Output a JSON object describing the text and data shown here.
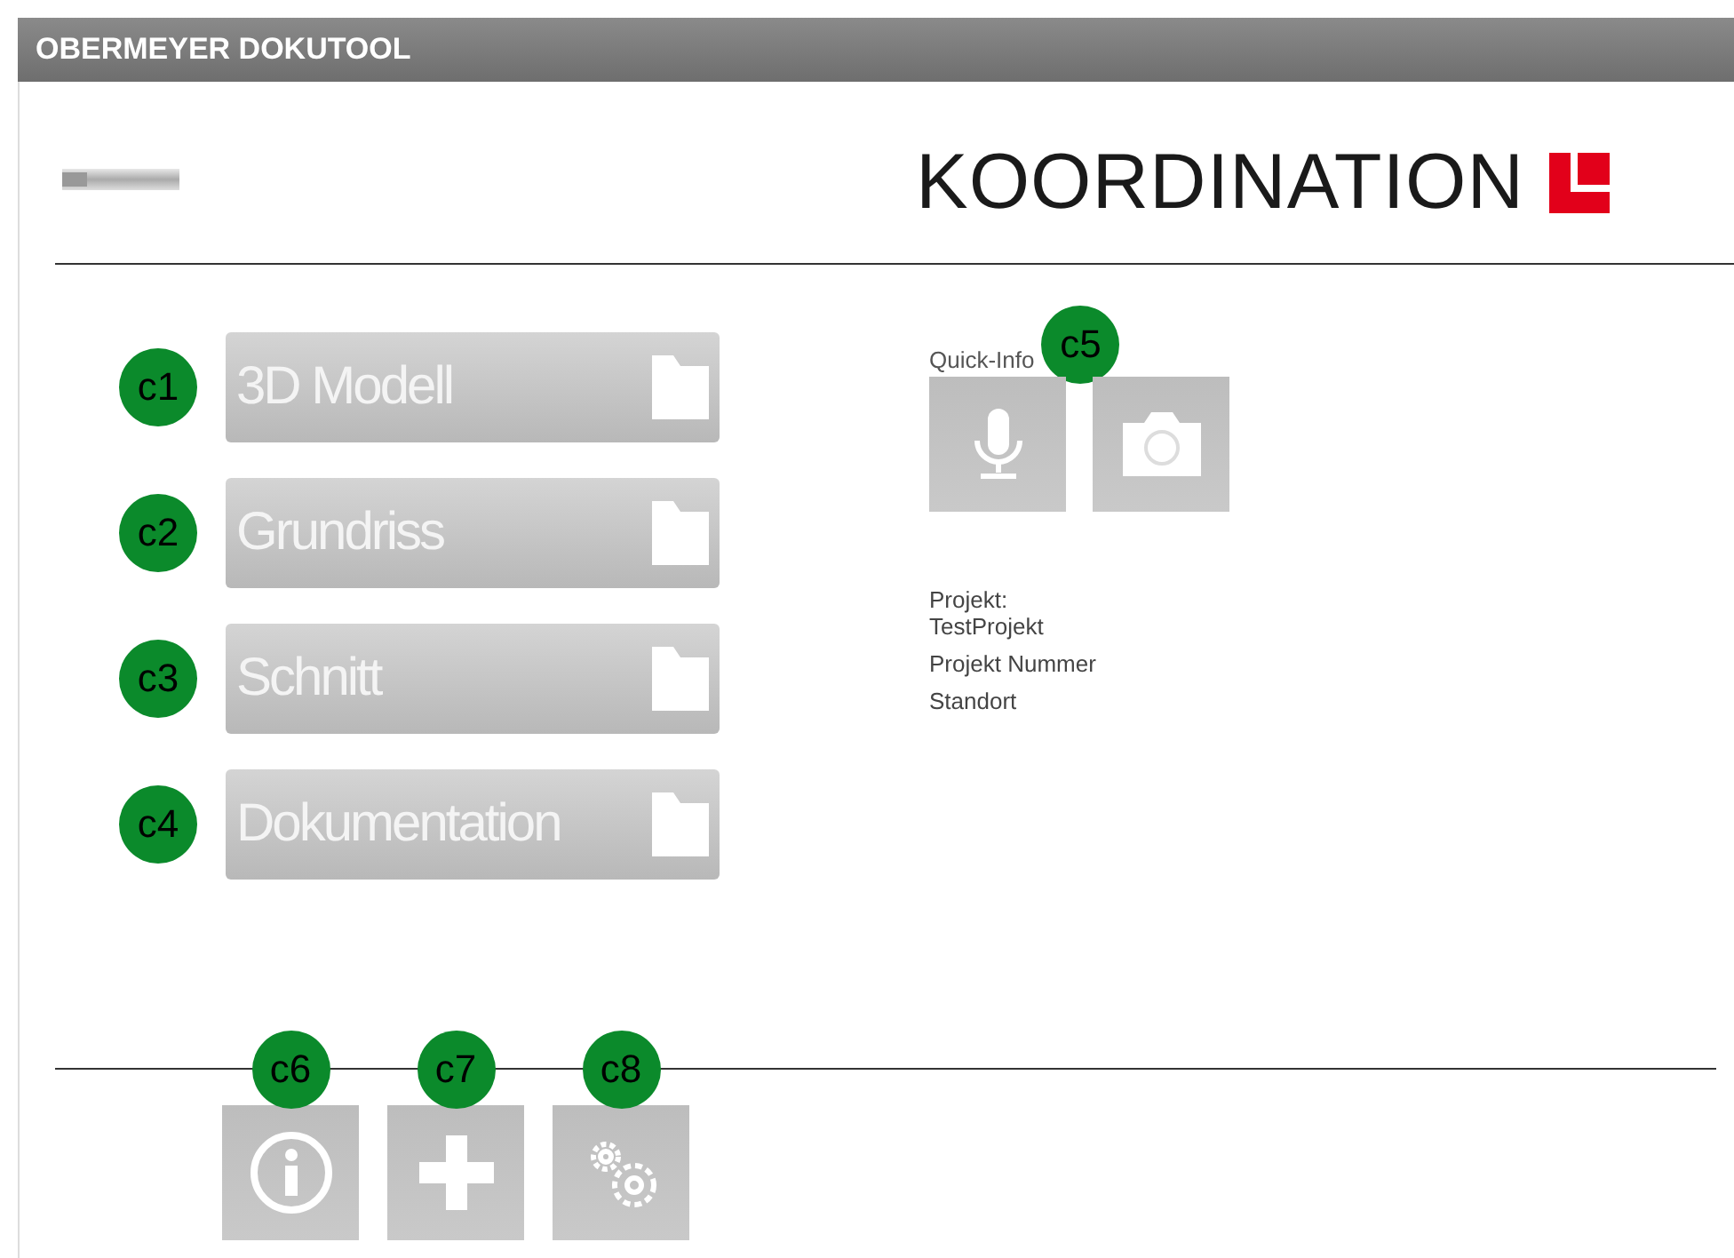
{
  "window": {
    "title": "OBERMEYER DOKUTOOL"
  },
  "header": {
    "title": "KOORDINATION"
  },
  "menu": [
    {
      "label": "3D Modell",
      "callout": "c1"
    },
    {
      "label": "Grundriss",
      "callout": "c2"
    },
    {
      "label": "Schnitt",
      "callout": "c3"
    },
    {
      "label": "Dokumentation",
      "callout": "c4"
    }
  ],
  "quick_info": {
    "label": "Quick-Info",
    "callout": "c5",
    "buttons": [
      {
        "kind": "microphone"
      },
      {
        "kind": "camera"
      }
    ]
  },
  "project_info": [
    "Projekt:\nTestProjekt",
    "Projekt Nummer",
    "Standort"
  ],
  "toolbar": [
    {
      "kind": "info",
      "callout": "c6"
    },
    {
      "kind": "add",
      "callout": "c7"
    },
    {
      "kind": "settings",
      "callout": "c8"
    }
  ]
}
